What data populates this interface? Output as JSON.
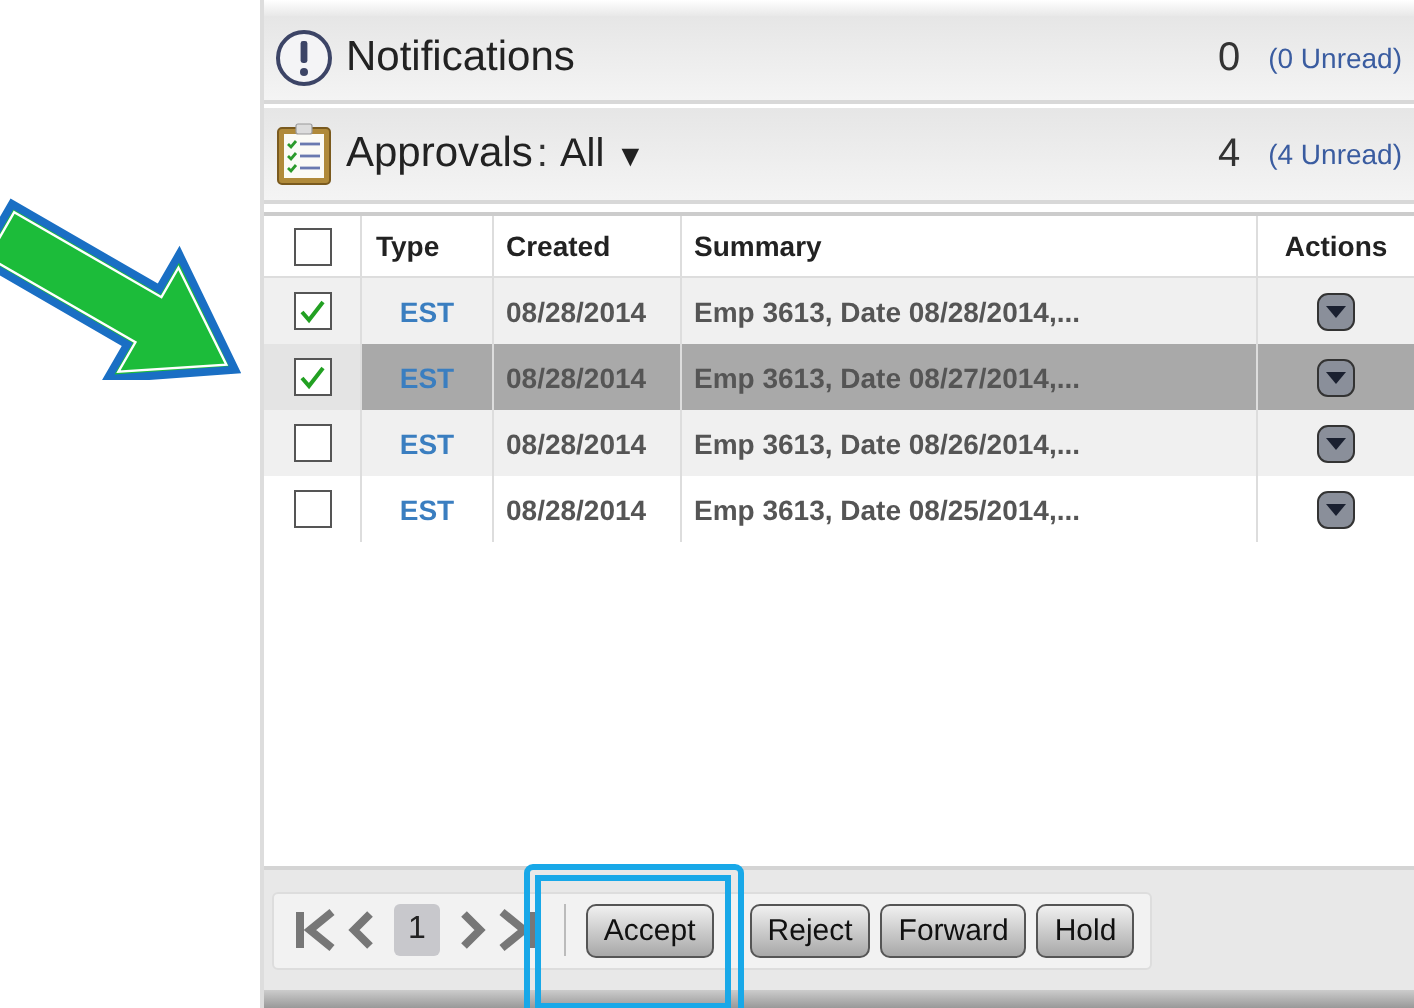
{
  "notifications": {
    "title": "Notifications",
    "count": "0",
    "unread": "(0 Unread)"
  },
  "approvals": {
    "title": "Approvals",
    "separator": ":",
    "filter": "All",
    "caret": "▼",
    "count": "4",
    "unread": "(4 Unread)"
  },
  "table": {
    "select_all": {
      "checked": false
    },
    "columns": [
      "Type",
      "Created",
      "Summary",
      "Actions"
    ],
    "rows": [
      {
        "checked": true,
        "selected": false,
        "type": "EST",
        "created": "08/28/2014",
        "summary": "Emp   3613, Date 08/28/2014,..."
      },
      {
        "checked": true,
        "selected": true,
        "type": "EST",
        "created": "08/28/2014",
        "summary": "Emp   3613, Date 08/27/2014,..."
      },
      {
        "checked": false,
        "selected": false,
        "type": "EST",
        "created": "08/28/2014",
        "summary": "Emp   3613, Date 08/26/2014,..."
      },
      {
        "checked": false,
        "selected": false,
        "type": "EST",
        "created": "08/28/2014",
        "summary": "Emp   3613, Date 08/25/2014,..."
      }
    ]
  },
  "pager": {
    "page": "1"
  },
  "buttons": [
    "Accept",
    "Reject",
    "Forward",
    "Hold"
  ]
}
